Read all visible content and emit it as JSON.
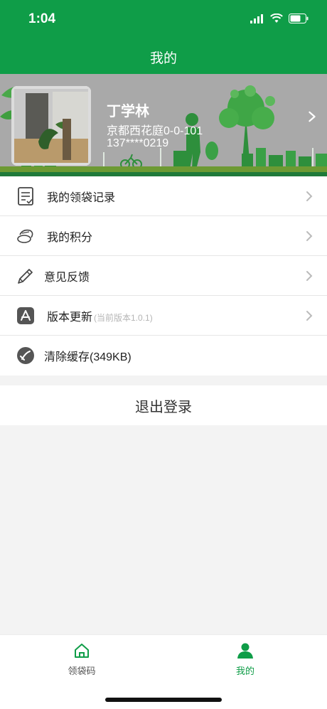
{
  "status_bar": {
    "time": "1:04"
  },
  "nav": {
    "title": "我的"
  },
  "profile": {
    "name": "丁学林",
    "address": "京都西花庭0-0-101",
    "phone": "137****0219"
  },
  "menu": {
    "bag_records": "我的领袋记录",
    "points": "我的积分",
    "feedback": "意见反馈",
    "version_update": "版本更新",
    "version_current": "(当前版本1.0.1)",
    "clear_cache": "清除缓存(349KB)"
  },
  "logout_label": "退出登录",
  "tabs": {
    "home": "领袋码",
    "mine": "我的"
  },
  "colors": {
    "brand_green": "#0f9d48",
    "banner_grey": "#a9a9a9"
  },
  "icons": {
    "bag_records": "document-list-icon",
    "points": "coins-icon",
    "feedback": "pencil-icon",
    "version_update": "app-store-icon",
    "clear_cache": "broom-icon",
    "home_tab": "home-icon",
    "mine_tab": "person-icon"
  }
}
